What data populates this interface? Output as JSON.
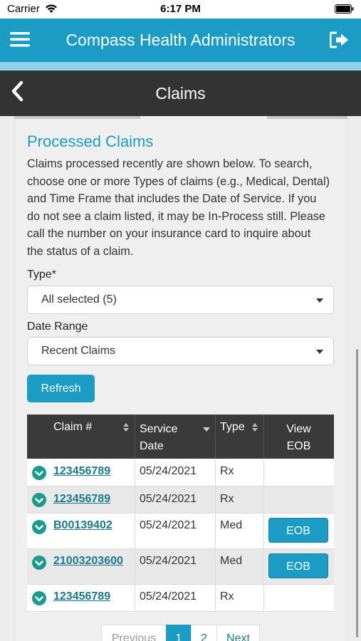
{
  "status_bar": {
    "carrier": "Carrier",
    "time": "6:17 PM"
  },
  "header": {
    "title": "Compass Health Administrators"
  },
  "sub_header": {
    "title": "Claims"
  },
  "section": {
    "title": "Processed Claims",
    "description": "Claims processed recently are shown below. To search, choose one or more Types of claims (e.g., Medical, Dental) and Time Frame that includes the Date of Service. If you do not see a claim listed, it may be In-Process still. Please call the number on your insurance card to inquire about the status of a claim."
  },
  "filters": {
    "type_label": "Type*",
    "type_value": "All selected (5)",
    "date_label": "Date Range",
    "date_value": "Recent Claims",
    "refresh_label": "Refresh"
  },
  "table": {
    "headers": {
      "claim": "Claim #",
      "service_date_1": "Service",
      "service_date_2": "Date",
      "type": "Type",
      "view_eob_1": "View",
      "view_eob_2": "EOB"
    },
    "rows": [
      {
        "claim": "123456789",
        "date": "05/24/2021",
        "type": "Rx",
        "eob": ""
      },
      {
        "claim": "123456789",
        "date": "05/24/2021",
        "type": "Rx",
        "eob": ""
      },
      {
        "claim": "B00139402",
        "date": "05/24/2021",
        "type": "Med",
        "eob": "EOB"
      },
      {
        "claim": "21003203600",
        "date": "05/24/2021",
        "type": "Med",
        "eob": "EOB"
      },
      {
        "claim": "123456789",
        "date": "05/24/2021",
        "type": "Rx",
        "eob": ""
      }
    ]
  },
  "pagination": {
    "prev": "Previous",
    "page1": "1",
    "page2": "2",
    "next": "Next"
  },
  "colors": {
    "brand": "#1a9cc4",
    "dark_bar": "#333333",
    "check": "#1a9c8c"
  },
  "icons": [
    "wifi-icon",
    "battery-icon",
    "menu-icon",
    "logout-icon",
    "back-icon",
    "caret-icon",
    "sort-icon",
    "check-circle-icon"
  ]
}
